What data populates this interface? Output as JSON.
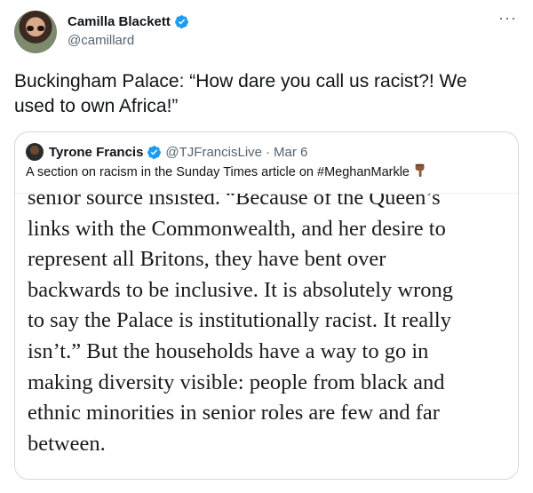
{
  "tweet": {
    "display_name": "Camilla Blackett",
    "handle": "@camillard",
    "more_icon": "more-horizontal-icon",
    "text": "Buckingham Palace: “How dare you call us racist?! We\nused to own Africa!”"
  },
  "quoted_tweet": {
    "display_name": "Tyrone Francis",
    "handle": "@TJFrancisLive",
    "separator": "·",
    "date": "Mar 6",
    "text": "A section on racism in the Sunday Times article on #MeghanMarkle",
    "emoji_icon": "pointing-down-hand-icon",
    "article_text": "senior source insisted. “Because of the Queen’s\nlinks with the Commonwealth, and her desire to\nrepresent all Britons, they have bent over\nbackwards to be inclusive. It is absolutely wrong\nto say the Palace is institutionally racist. It really\nisn’t.” But the households have a way to go in\nmaking diversity visible: people from black and\nethnic minorities in senior roles are few and far\nbetween."
  },
  "colors": {
    "verified_blue": "#1d9bf0",
    "secondary_text": "#536471",
    "border": "#cfd9de"
  }
}
